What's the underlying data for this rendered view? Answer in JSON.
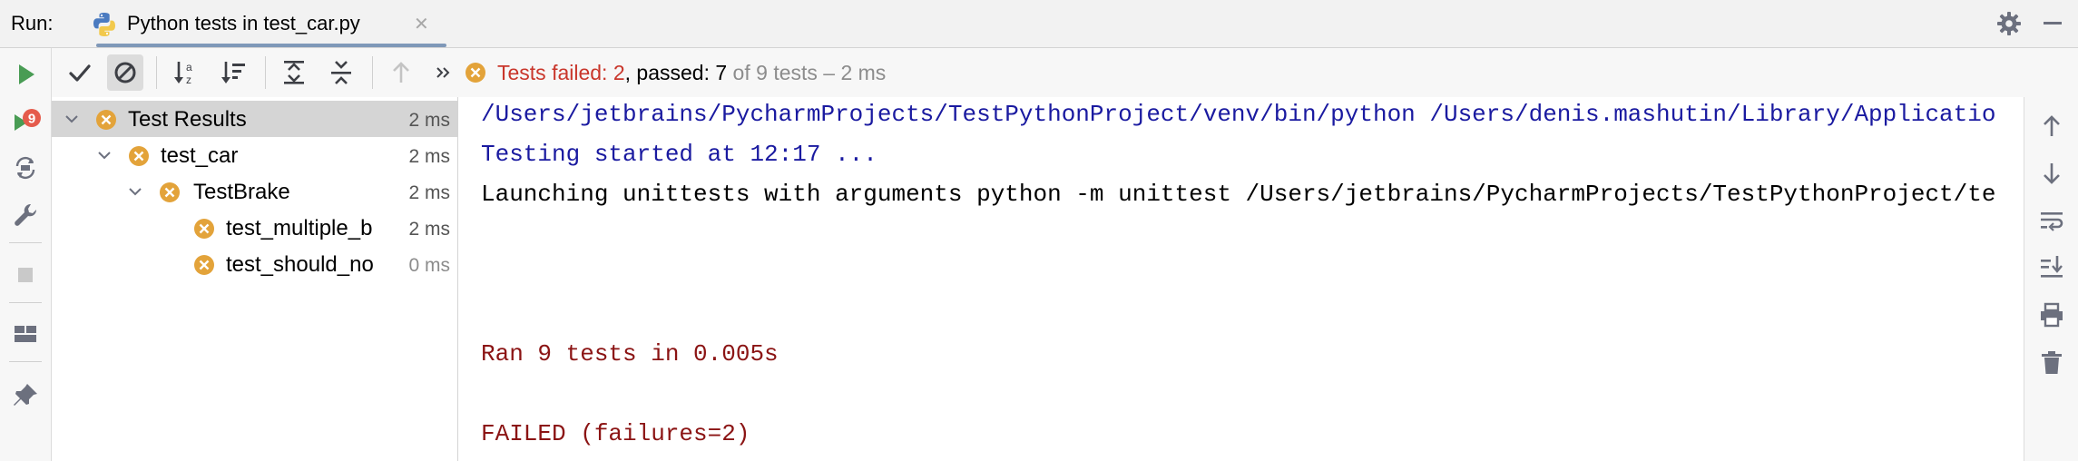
{
  "titlebar": {
    "run_label": "Run:",
    "tab_title": "Python tests in test_car.py",
    "tab_icon": "python-icon",
    "close_glyph": "✕"
  },
  "status": {
    "failed": "Tests failed: 2",
    "passed": ", passed: 7",
    "of": " of 9 tests – 2 ms"
  },
  "tree": [
    {
      "label": "Test Results",
      "time": "2 ms",
      "level": 0,
      "expanded": true
    },
    {
      "label": "test_car",
      "time": "2 ms",
      "level": 1,
      "expanded": true
    },
    {
      "label": "TestBrake",
      "time": "2 ms",
      "level": 2,
      "expanded": true
    },
    {
      "label": "test_multiple_b",
      "time": "2 ms",
      "level": 3
    },
    {
      "label": "test_should_no",
      "time": "0 ms",
      "level": 3
    }
  ],
  "console": [
    "/Users/jetbrains/PycharmProjects/TestPythonProject/venv/bin/python /Users/denis.mashutin/Library/Applicatio",
    "Testing started at 12:17 ...",
    "Launching unittests with arguments python -m unittest /Users/jetbrains/PycharmProjects/TestPythonProject/te",
    "Ran 9 tests in 0.005s",
    "FAILED (failures=2)"
  ],
  "badge_count": "9",
  "colors": {
    "run_green": "#499c54",
    "error_orange": "#e3a33a",
    "failed_red": "#c9362b",
    "console_blue": "#1a1aa0",
    "console_red": "#8b1414"
  }
}
